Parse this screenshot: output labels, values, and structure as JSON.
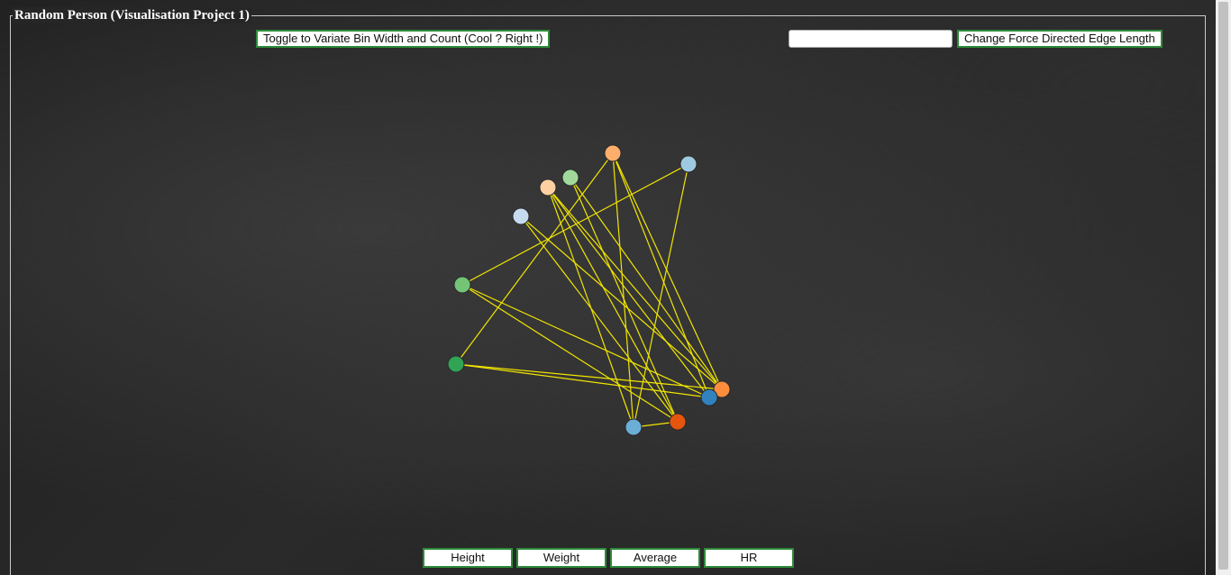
{
  "page": {
    "title": "Random Person (Visualisation Project 1)"
  },
  "toolbar": {
    "toggle_label": "Toggle to Variate Bin Width and Count (Cool ? Right !)",
    "edge_input_value": "",
    "edge_button_label": "Change Force Directed Edge Length"
  },
  "bottom_buttons": {
    "height": "Height",
    "weight": "Weight",
    "average": "Average",
    "hr": "HR"
  },
  "graph": {
    "edge_color": "#f2e600",
    "nodes": [
      {
        "id": 0,
        "color": "#fdae6b"
      },
      {
        "id": 1,
        "color": "#9ecae1"
      },
      {
        "id": 2,
        "color": "#a1d99b"
      },
      {
        "id": 3,
        "color": "#fdd0a2"
      },
      {
        "id": 4,
        "color": "#c6dbef"
      },
      {
        "id": 5,
        "color": "#74c476"
      },
      {
        "id": 6,
        "color": "#31a354"
      },
      {
        "id": 7,
        "color": "#fd8d3c"
      },
      {
        "id": 8,
        "color": "#3182bd"
      },
      {
        "id": 9,
        "color": "#e6550d"
      },
      {
        "id": 10,
        "color": "#6baed6"
      }
    ],
    "edges": [
      [
        0,
        6
      ],
      [
        0,
        7
      ],
      [
        0,
        8
      ],
      [
        0,
        10
      ],
      [
        1,
        5
      ],
      [
        1,
        10
      ],
      [
        2,
        7
      ],
      [
        2,
        9
      ],
      [
        3,
        8
      ],
      [
        3,
        9
      ],
      [
        3,
        10
      ],
      [
        3,
        7
      ],
      [
        4,
        7
      ],
      [
        4,
        9
      ],
      [
        5,
        8
      ],
      [
        5,
        9
      ],
      [
        6,
        7
      ],
      [
        6,
        8
      ],
      [
        9,
        10
      ]
    ]
  }
}
